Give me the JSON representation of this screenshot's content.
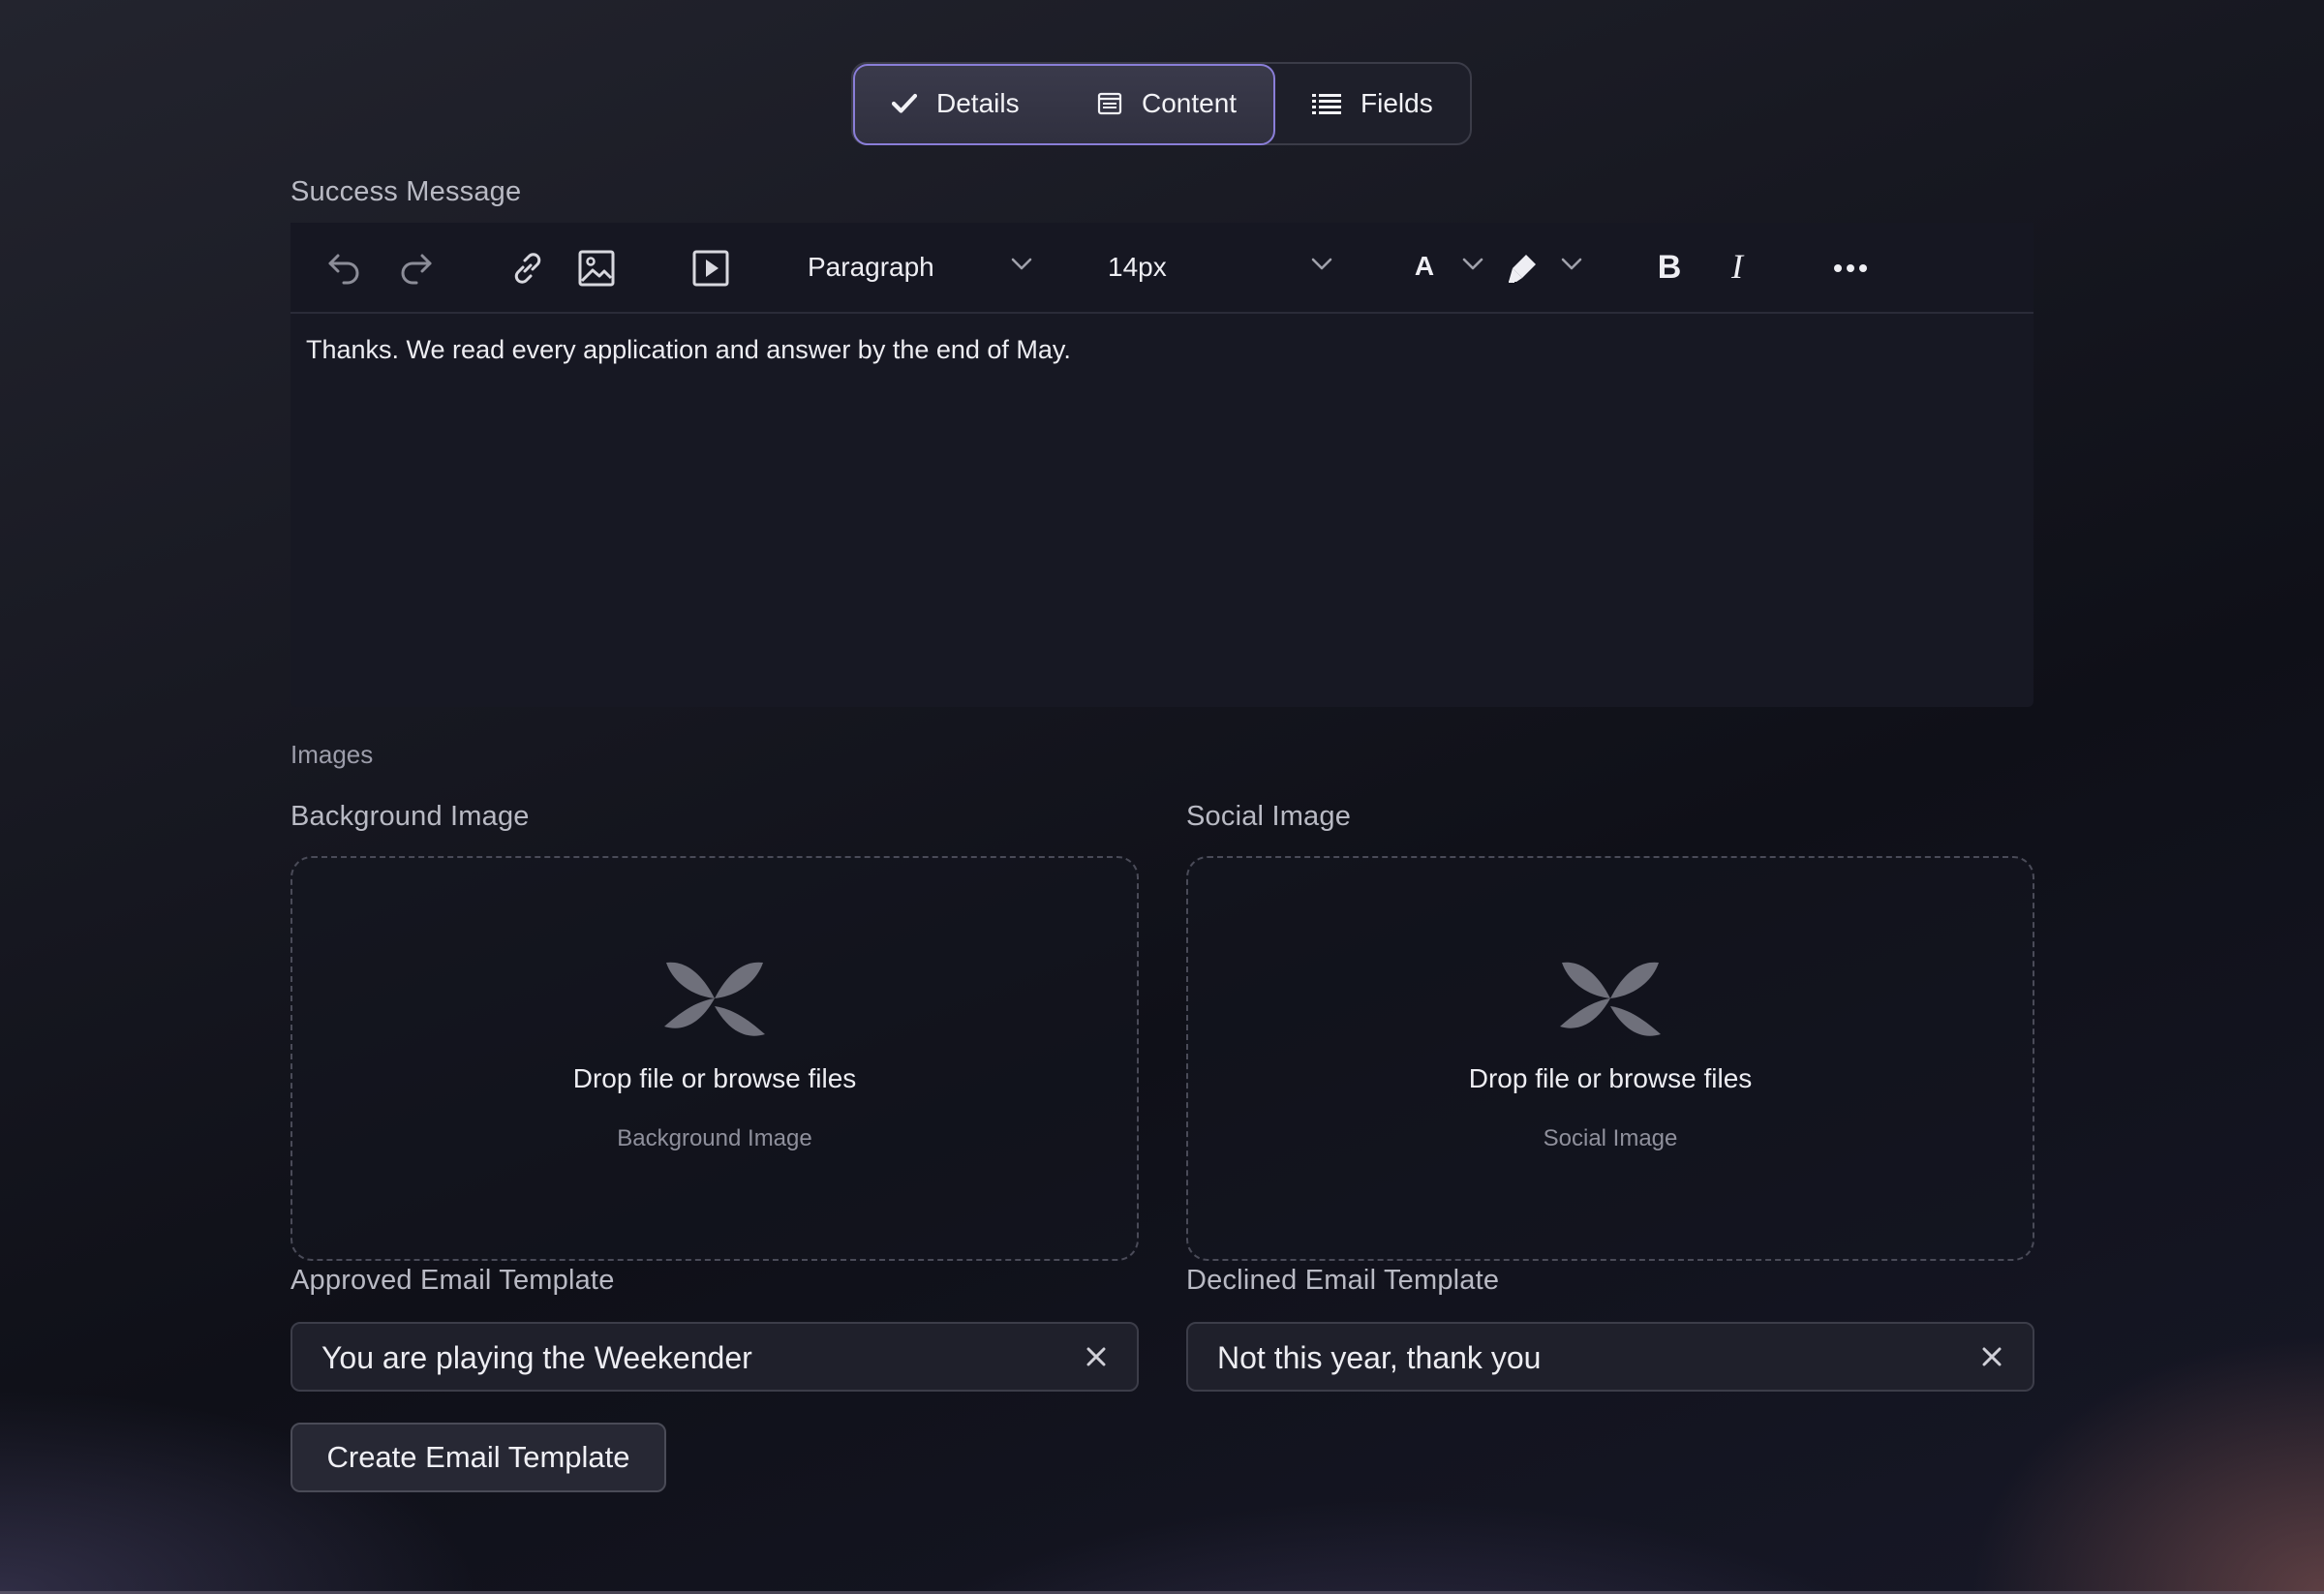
{
  "tabs": [
    {
      "label": "Details",
      "icon": "check-icon",
      "selected": true
    },
    {
      "label": "Content",
      "icon": "content-icon",
      "selected": true
    },
    {
      "label": "Fields",
      "icon": "list-icon",
      "selected": false
    }
  ],
  "success_message": {
    "label": "Success Message",
    "toolbar": {
      "paragraph_label": "Paragraph",
      "font_size": "14px",
      "text_color_letter": "A",
      "bold_letter": "B",
      "italic_letter": "I"
    },
    "content": "Thanks. We read every application and answer by the end of May."
  },
  "images": {
    "section_label": "Images",
    "background": {
      "label": "Background Image",
      "drop_text": "Drop file or browse files",
      "sub_text": "Background Image"
    },
    "social": {
      "label": "Social Image",
      "drop_text": "Drop file or browse files",
      "sub_text": "Social Image"
    }
  },
  "templates": {
    "approved": {
      "label": "Approved Email Template",
      "value": "You are playing the Weekender"
    },
    "declined": {
      "label": "Declined Email Template",
      "value": "Not this year, thank you"
    },
    "create_button": "Create Email Template"
  },
  "colors": {
    "accent": "#8a7ed8",
    "background": "#151620"
  }
}
